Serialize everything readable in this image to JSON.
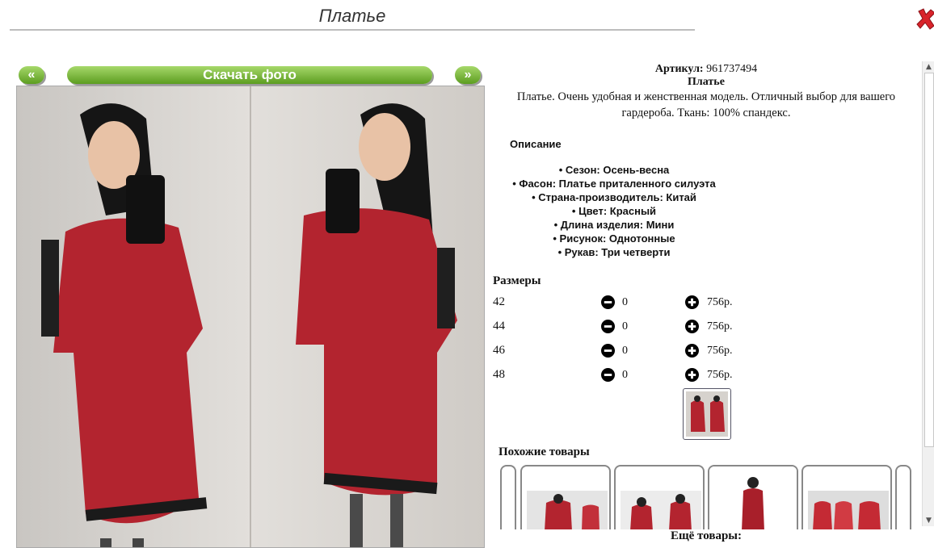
{
  "header": {
    "title": "Платье"
  },
  "nav": {
    "prev": "«",
    "download": "Скачать фото",
    "next": "»"
  },
  "product": {
    "article_label": "Артикул:",
    "article_value": "961737494",
    "name": "Платье",
    "description": "Платье. Очень удобная и женственная модель. Отличный выбор для вашего гардероба. Ткань: 100% спандекс.",
    "section_title": "Описание",
    "props": [
      "• Сезон: Осень-весна",
      "• Фасон: Платье приталенного силуэта",
      "• Страна-производитель: Китай",
      "• Цвет: Красный",
      "• Длина изделия: Мини",
      "• Рисунок: Однотонные",
      "• Рукав: Три четверти"
    ]
  },
  "sizes": {
    "title": "Размеры",
    "rows": [
      {
        "size": "42",
        "qty": "0",
        "price": "756р."
      },
      {
        "size": "44",
        "qty": "0",
        "price": "756р."
      },
      {
        "size": "46",
        "qty": "0",
        "price": "756р."
      },
      {
        "size": "48",
        "qty": "0",
        "price": "756р."
      }
    ]
  },
  "similar": {
    "title": "Похожие товары"
  },
  "more": {
    "label": "Ещё товары:"
  },
  "colors": {
    "accent_green": "#6aa82b",
    "dress_red": "#b3242f",
    "close_red": "#d8232a"
  },
  "icons": [
    "close-icon",
    "minus-icon",
    "plus-icon"
  ]
}
